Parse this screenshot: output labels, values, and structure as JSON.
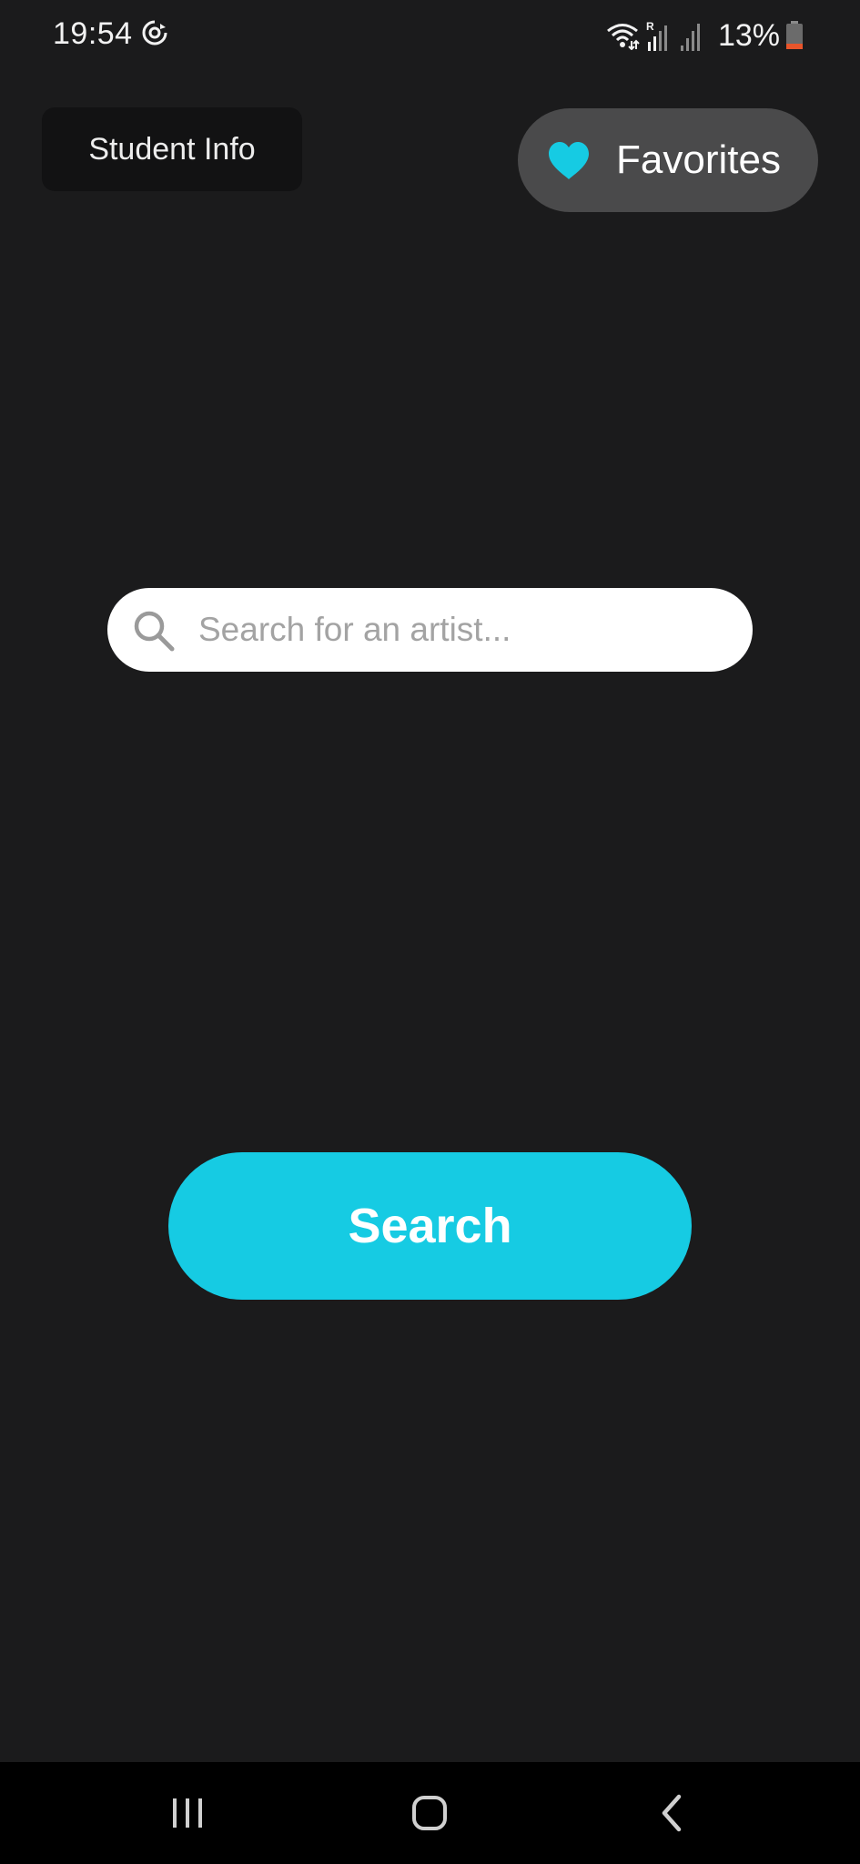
{
  "status_bar": {
    "time": "19:54",
    "battery": "13%",
    "icons": [
      "sync-icon",
      "wifi-icon",
      "roaming-signal-icon",
      "signal-icon",
      "battery-icon"
    ],
    "battery_level": 0.13,
    "battery_low_color": "#e8552b"
  },
  "header": {
    "student_info_label": "Student Info",
    "favorites_label": "Favorites",
    "favorites_icon": "heart-icon"
  },
  "search": {
    "placeholder": "Search for an artist...",
    "value": "",
    "icon": "search-icon",
    "button_label": "Search"
  },
  "nav_bar": {
    "items": [
      "recent-apps-icon",
      "home-icon",
      "back-icon"
    ]
  },
  "colors": {
    "background": "#1b1b1c",
    "accent": "#16cbe3",
    "favorites_pill": "#4a4a4b",
    "student_info_button": "#121213"
  }
}
